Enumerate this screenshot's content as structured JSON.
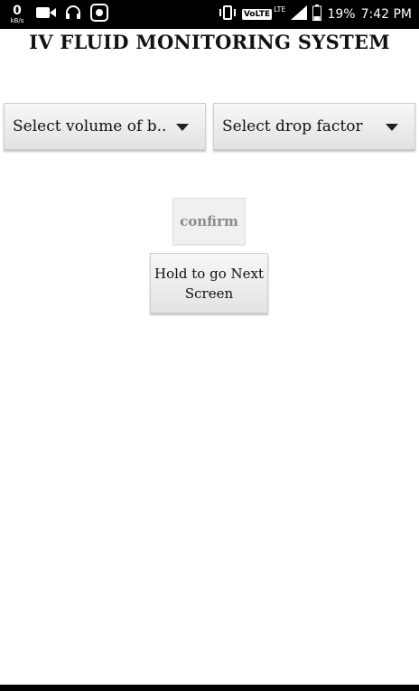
{
  "status_bar": {
    "data_speed": "0",
    "data_unit": "kB/s",
    "volte": "VoLTE",
    "network": "LTE",
    "battery": "19%",
    "time": "7:42 PM",
    "icons": [
      "video-camera-icon",
      "headphones-icon",
      "app-notification-icon",
      "vibrate-icon",
      "signal-icon",
      "battery-icon"
    ]
  },
  "app": {
    "title": "IV FLUID MONITORING SYSTEM"
  },
  "spinners": {
    "volume": "Select volume of b..",
    "drop_factor": "Select drop factor"
  },
  "buttons": {
    "confirm": "confirm",
    "next_line1": "Hold to go Next",
    "next_line2": "Screen"
  }
}
